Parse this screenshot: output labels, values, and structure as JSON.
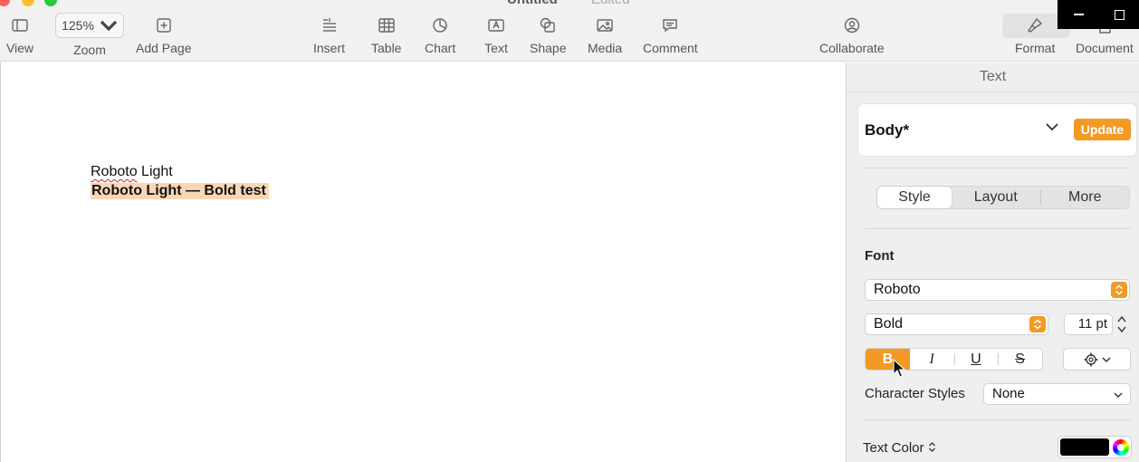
{
  "window": {
    "title": "Untitled",
    "status": "Edited"
  },
  "toolbar": {
    "view": "View",
    "zoom_value": "125%",
    "zoom": "Zoom",
    "add_page": "Add Page",
    "insert": "Insert",
    "table": "Table",
    "chart": "Chart",
    "text": "Text",
    "shape": "Shape",
    "media": "Media",
    "comment": "Comment",
    "collaborate": "Collaborate",
    "format": "Format",
    "document": "Document"
  },
  "document": {
    "line1": "Roboto Light",
    "line2": "Roboto Light — Bold test"
  },
  "inspector": {
    "title": "Text",
    "paragraph_style": "Body*",
    "update_label": "Update",
    "tabs": [
      "Style",
      "Layout",
      "More"
    ],
    "selected_tab": "Style",
    "font_label": "Font",
    "font_family": "Roboto",
    "font_style": "Bold",
    "font_size": "11 pt",
    "format_buttons": [
      "B",
      "I",
      "U",
      "S"
    ],
    "active_format": "B",
    "character_styles_label": "Character Styles",
    "character_style_value": "None",
    "text_color_label": "Text Color",
    "text_color": "#000000",
    "accent_color": "#f29a24"
  }
}
